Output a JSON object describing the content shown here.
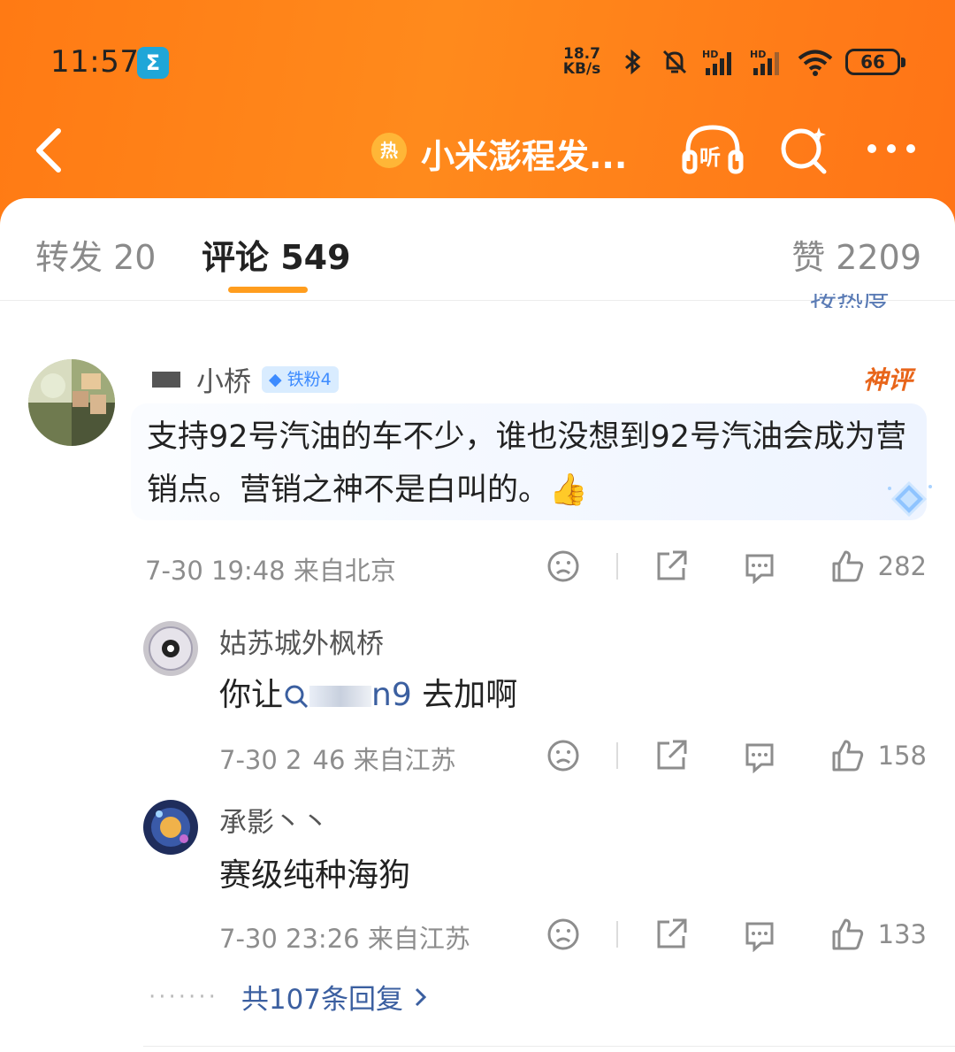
{
  "status_bar": {
    "time": "11:57",
    "app_badge": "Σ",
    "net_speed_value": "18.7",
    "net_speed_unit": "KB/s",
    "battery": "66"
  },
  "nav": {
    "hot_badge": "热",
    "title": "小米澎程发..."
  },
  "tabs": [
    {
      "label": "转发 20"
    },
    {
      "label": "评论 549"
    },
    {
      "label": "赞 2209"
    }
  ],
  "comment": {
    "username": "小桥",
    "fan_badge": "铁粉4",
    "god_label": "神评",
    "text": "支持92号汽油的车不少，谁也没想到92号汽油会成为营销点。营销之神不是白叫的。👍",
    "time": "7-30 19:48",
    "location": "来自北京",
    "likes": "282"
  },
  "replies": [
    {
      "name": "姑苏城外枫桥",
      "text_prefix": "你让",
      "mention": "n9",
      "text_suffix": " 去加啊",
      "time": "7-30 2",
      "time_tail": "46",
      "location": "来自江苏",
      "likes": "158"
    },
    {
      "name": "承影丶丶",
      "text": "赛级纯种海狗",
      "time": "7-30 23:26",
      "location": "来自江苏",
      "likes": "133"
    }
  ],
  "more_replies": {
    "dots": "·······",
    "label": "共107条回复"
  },
  "colors": {
    "header": "#ff7a14",
    "accent": "#ff9d1e",
    "link": "#3b5fa0",
    "god": "#e8651a"
  }
}
